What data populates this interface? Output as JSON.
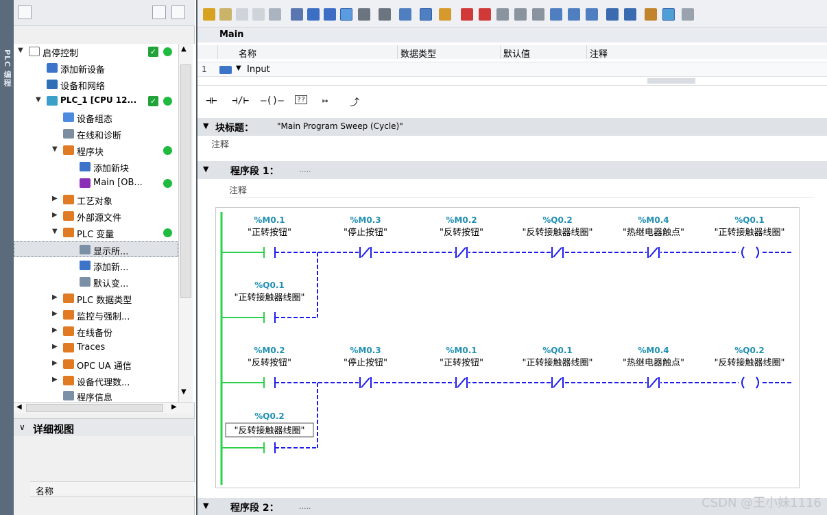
{
  "sidebar_strip": {
    "label": "PLC 编程"
  },
  "tree": {
    "items": [
      {
        "label": "启停控制"
      },
      {
        "label": "添加新设备"
      },
      {
        "label": "设备和网络"
      },
      {
        "label": "PLC_1 [CPU 12..."
      },
      {
        "label": "设备组态"
      },
      {
        "label": "在线和诊断"
      },
      {
        "label": "程序块"
      },
      {
        "label": "添加新块"
      },
      {
        "label": "Main [OB..."
      },
      {
        "label": "工艺对象"
      },
      {
        "label": "外部源文件"
      },
      {
        "label": "PLC 变量"
      },
      {
        "label": "显示所..."
      },
      {
        "label": "添加新..."
      },
      {
        "label": "默认变..."
      },
      {
        "label": "PLC 数据类型"
      },
      {
        "label": "监控与强制..."
      },
      {
        "label": "在线备份"
      },
      {
        "label": "Traces"
      },
      {
        "label": "OPC UA 通信"
      },
      {
        "label": "设备代理数..."
      },
      {
        "label": "程序信息"
      }
    ]
  },
  "detail": {
    "title": "详细视图",
    "column": "名称"
  },
  "editor": {
    "block_name": "Main",
    "interface": {
      "headers": [
        "名称",
        "数据类型",
        "默认值",
        "注释"
      ],
      "row_num": "1",
      "row_name": "Input"
    },
    "block_title_label": "块标题：",
    "block_title_value": "\"Main Program Sweep (Cycle)\"",
    "block_comment": "注释",
    "network1_title": "程序段 1：",
    "network1_dots": ".....",
    "network1_comment": "注释",
    "network2_title": "程序段 2：",
    "network2_dots": "....."
  },
  "rung1": {
    "contacts": [
      {
        "addr": "%M0.1",
        "name": "\"正转按钮\""
      },
      {
        "addr": "%M0.3",
        "name": "\"停止按钮\""
      },
      {
        "addr": "%M0.2",
        "name": "\"反转按钮\""
      },
      {
        "addr": "%Q0.2",
        "name": "\"反转接触器线圈\""
      },
      {
        "addr": "%M0.4",
        "name": "\"热继电器触点\""
      }
    ],
    "coil": {
      "addr": "%Q0.1",
      "name": "\"正转接触器线圈\""
    },
    "seal": {
      "addr": "%Q0.1",
      "name": "\"正转接触器线圈\""
    }
  },
  "rung2": {
    "contacts": [
      {
        "addr": "%M0.2",
        "name": "\"反转按钮\""
      },
      {
        "addr": "%M0.3",
        "name": "\"停止按钮\""
      },
      {
        "addr": "%M0.1",
        "name": "\"正转按钮\""
      },
      {
        "addr": "%Q0.1",
        "name": "\"正转接触器线圈\""
      },
      {
        "addr": "%M0.4",
        "name": "\"热继电器触点\""
      }
    ],
    "coil": {
      "addr": "%Q0.2",
      "name": "\"反转接触器线圈\""
    },
    "seal": {
      "addr": "%Q0.2",
      "name": "\"反转接触器线圈\""
    }
  },
  "watermark": "CSDN @王小妹1116",
  "colors": {
    "rail": "#2bd14a",
    "wire": "#1a1aee",
    "addr": "#1f8fb0"
  }
}
